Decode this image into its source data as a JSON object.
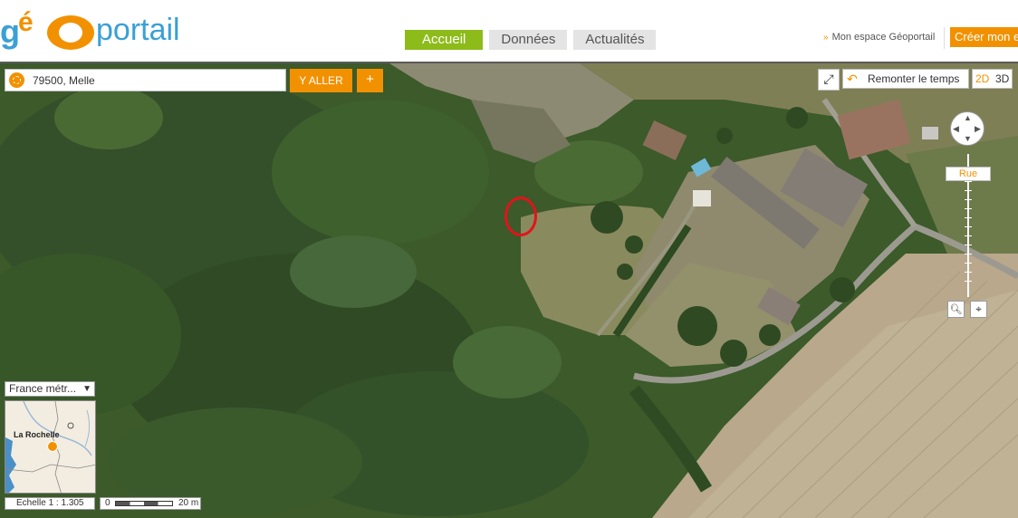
{
  "header": {
    "logo": {
      "g": "g",
      "e": "é",
      "portail": "portail"
    },
    "nav": [
      "Accueil",
      "Données",
      "Actualités"
    ],
    "user_link": "Mon espace Géoportail",
    "create_button": "Créer mon espace"
  },
  "search": {
    "value": "79500, Melle",
    "go_label": "Y ALLER",
    "plus_label": "+"
  },
  "map_controls": {
    "timeline_label": "Remonter le temps",
    "view_2d": "2D",
    "view_3d": "3D",
    "zoom_level_label": "Rue"
  },
  "overview": {
    "territory": "France métr...",
    "place_label": "La Rochelle"
  },
  "scale": {
    "text": "Echelle 1 :  1.305",
    "bar_start": "0",
    "bar_end": "20 m"
  },
  "colors": {
    "accent": "#f29100",
    "active_tab": "#8dbb1a",
    "marker": "#e3131b"
  }
}
